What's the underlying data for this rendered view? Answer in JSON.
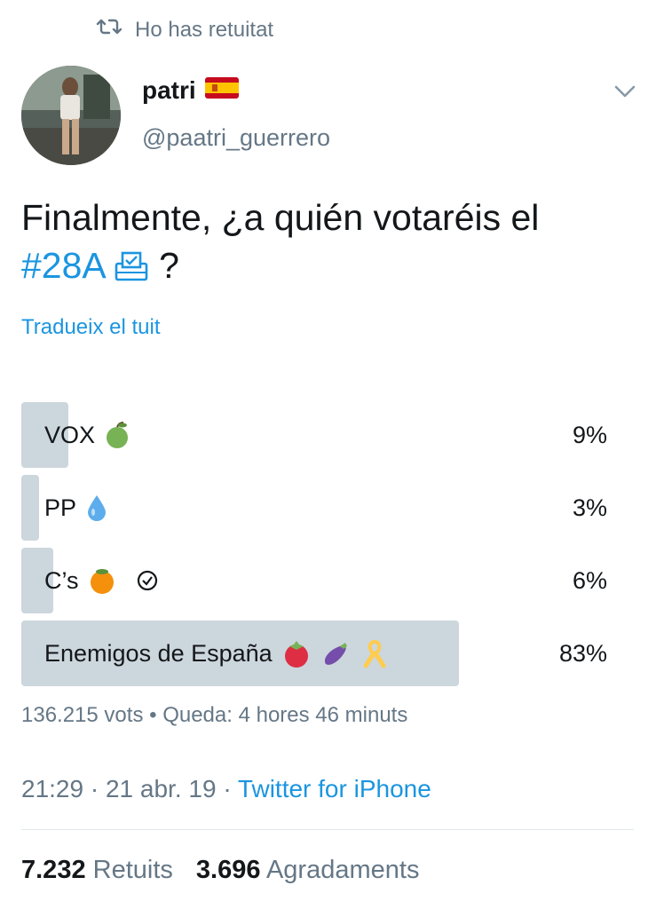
{
  "retweet": {
    "icon": "retweet-icon",
    "label": "Ho has retuitat"
  },
  "author": {
    "name": "patri",
    "flag": "spain-flag-icon",
    "handle": "@paatri_guerrero",
    "avatar": "profile-avatar"
  },
  "menu_icon": "chevron-down-icon",
  "tweet": {
    "text": "Finalmente, ¿a quién votaréis el",
    "hashtag": "#28A",
    "ballot_icon": "ballot-box-icon",
    "end": "?"
  },
  "translate_link": "Tradueix el tuit",
  "poll": {
    "options": [
      {
        "label": "VOX",
        "percent": 9,
        "percent_label": "9%",
        "emoji": [
          "green-apple-icon"
        ]
      },
      {
        "label": "PP",
        "percent": 3,
        "percent_label": "3%",
        "emoji": [
          "droplet-icon"
        ]
      },
      {
        "label": "C’s",
        "percent": 6,
        "percent_label": "6%",
        "emoji": [
          "tangerine-icon",
          "check-circle-icon"
        ]
      },
      {
        "label": "Enemigos de España",
        "percent": 83,
        "percent_label": "83%",
        "emoji": [
          "tomato-icon",
          "eggplant-icon",
          "yellow-ribbon-icon"
        ]
      }
    ],
    "votes": "136.215 vots",
    "separator": "•",
    "remaining": "Queda: 4 hores 46 minuts"
  },
  "meta": {
    "time": "21:29",
    "sep1": "·",
    "date": "21 abr. 19",
    "sep2": "·",
    "source": "Twitter for iPhone"
  },
  "stats": {
    "retweets_count": "7.232",
    "retweets_label": "Retuits",
    "likes_count": "3.696",
    "likes_label": "Agradaments"
  },
  "colors": {
    "link": "#1b95e0",
    "secondary": "#657786",
    "poll_bar": "#ccd6dd",
    "text": "#14171a"
  }
}
